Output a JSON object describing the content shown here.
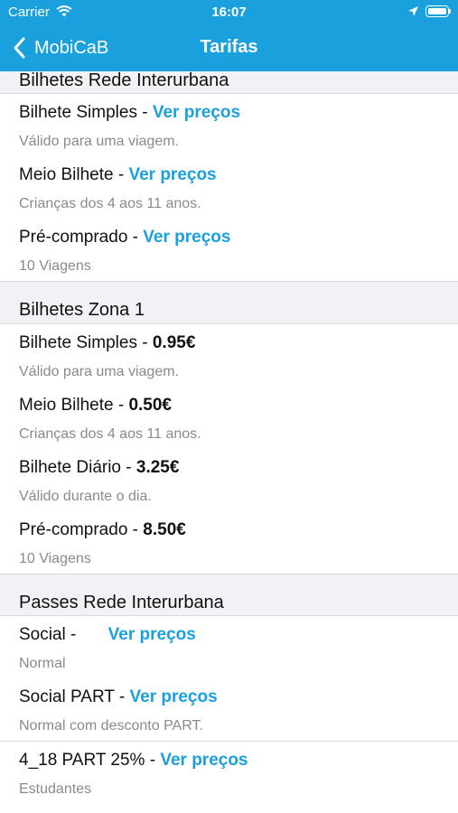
{
  "status": {
    "carrier": "Carrier",
    "time": "16:07"
  },
  "nav": {
    "back_label": "MobiCaB",
    "title": "Tarifas"
  },
  "sections": [
    {
      "title": "Bilhetes Rede Interurbana",
      "rows": [
        {
          "label": "Bilhete Simples - ",
          "link": "Ver preços",
          "subtitle": "Válido para uma viagem."
        },
        {
          "label": "Meio Bilhete - ",
          "link": "Ver preços",
          "subtitle": "Crianças dos 4 aos 11 anos."
        },
        {
          "label": "Pré-comprado - ",
          "link": "Ver preços",
          "subtitle": "10 Viagens"
        }
      ]
    },
    {
      "title": "Bilhetes Zona 1",
      "rows": [
        {
          "label": "Bilhete Simples - ",
          "price": "0.95€",
          "subtitle": "Válido para uma viagem."
        },
        {
          "label": "Meio Bilhete - ",
          "price": "0.50€",
          "subtitle": "Crianças dos 4 aos 11 anos."
        },
        {
          "label": "Bilhete Diário - ",
          "price": "3.25€",
          "subtitle": "Válido durante o dia."
        },
        {
          "label": "Pré-comprado - ",
          "price": "8.50€",
          "subtitle": "10 Viagens"
        }
      ]
    },
    {
      "title": "Passes Rede Interurbana",
      "rows": [
        {
          "label": "Social - ",
          "link": "Ver preços",
          "subtitle": "Normal"
        },
        {
          "label": "Social PART - ",
          "link": "Ver preços",
          "subtitle": "Normal com desconto PART."
        },
        {
          "label": "4_18 PART 25% - ",
          "link": "Ver preços",
          "subtitle": "Estudantes"
        }
      ]
    }
  ],
  "colors": {
    "accent": "#1aa0dc",
    "section_bg": "#f2f2f6",
    "subtitle": "#8a8a8e"
  }
}
